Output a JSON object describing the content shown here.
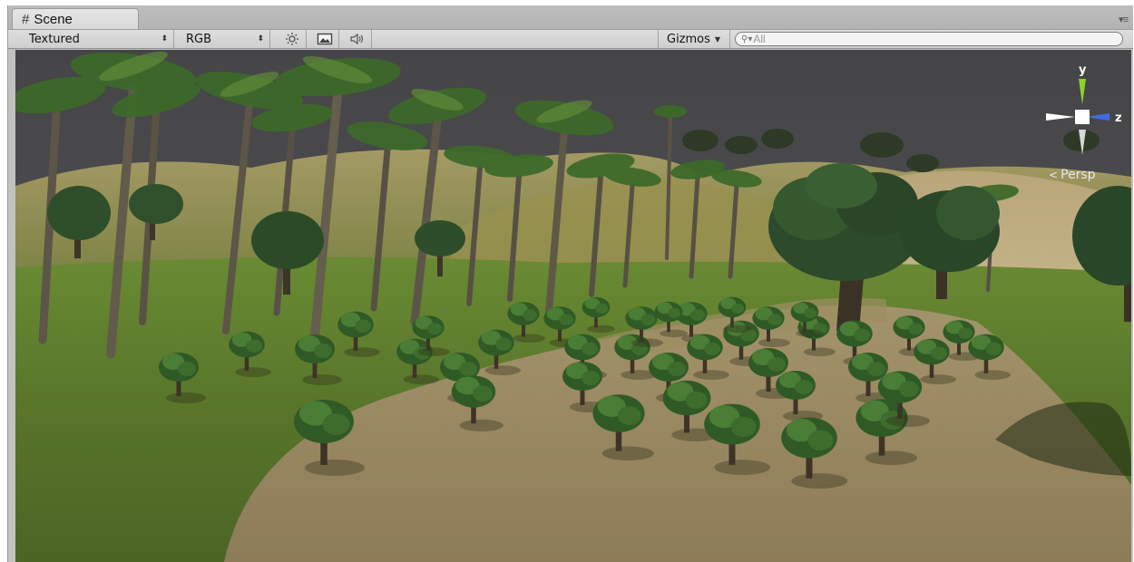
{
  "tab": {
    "title": "Scene",
    "icon": "scene-grid-icon"
  },
  "toolbar": {
    "render_mode": "Textured",
    "color_mode": "RGB",
    "lighting_icon": "sun-icon",
    "fx_icon": "image-icon",
    "audio_icon": "speaker-icon",
    "gizmos_label": "Gizmos",
    "search_placeholder": "All"
  },
  "viewport": {
    "gizmo": {
      "y_axis": "y",
      "z_axis": "z",
      "colors": {
        "y": "#8fd22a",
        "z": "#3d6ee0",
        "x": "#ffffff"
      }
    },
    "projection_label": "Persp"
  }
}
